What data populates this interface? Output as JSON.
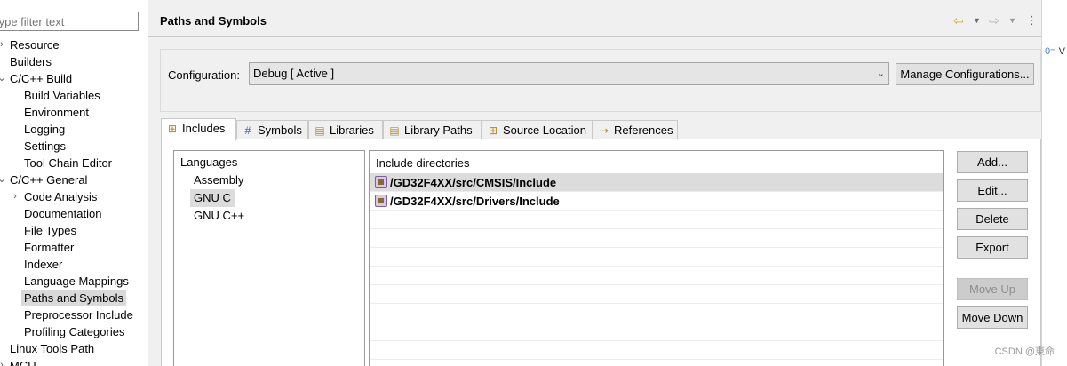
{
  "filter": {
    "placeholder": "type filter text"
  },
  "tree": [
    {
      "label": "Resource",
      "twisty": "›",
      "indent": 0
    },
    {
      "label": "Builders",
      "twisty": "",
      "indent": 0
    },
    {
      "label": "C/C++ Build",
      "twisty": "⌄",
      "indent": 0
    },
    {
      "label": "Build Variables",
      "twisty": "",
      "indent": 1
    },
    {
      "label": "Environment",
      "twisty": "",
      "indent": 1
    },
    {
      "label": "Logging",
      "twisty": "",
      "indent": 1
    },
    {
      "label": "Settings",
      "twisty": "",
      "indent": 1
    },
    {
      "label": "Tool Chain Editor",
      "twisty": "",
      "indent": 1
    },
    {
      "label": "C/C++ General",
      "twisty": "⌄",
      "indent": 0
    },
    {
      "label": "Code Analysis",
      "twisty": "›",
      "indent": 1
    },
    {
      "label": "Documentation",
      "twisty": "",
      "indent": 1
    },
    {
      "label": "File Types",
      "twisty": "",
      "indent": 1
    },
    {
      "label": "Formatter",
      "twisty": "",
      "indent": 1
    },
    {
      "label": "Indexer",
      "twisty": "",
      "indent": 1
    },
    {
      "label": "Language Mappings",
      "twisty": "",
      "indent": 1
    },
    {
      "label": "Paths and Symbols",
      "twisty": "",
      "indent": 1,
      "selected": true
    },
    {
      "label": "Preprocessor Include",
      "twisty": "",
      "indent": 1
    },
    {
      "label": "Profiling Categories",
      "twisty": "",
      "indent": 1
    },
    {
      "label": "Linux Tools Path",
      "twisty": "",
      "indent": 0
    },
    {
      "label": "MCU",
      "twisty": "›",
      "indent": 0
    }
  ],
  "page": {
    "title": "Paths and Symbols"
  },
  "config": {
    "label": "Configuration:",
    "value": "Debug  [ Active ]",
    "manage_label": "Manage Configurations..."
  },
  "tabs": [
    {
      "label": "Includes",
      "icon": "includes-icon",
      "glyph": "⊞"
    },
    {
      "label": "Symbols",
      "icon": "hash-icon",
      "glyph": "#"
    },
    {
      "label": "Libraries",
      "icon": "library-icon",
      "glyph": "▤"
    },
    {
      "label": "Library Paths",
      "icon": "library-path-icon",
      "glyph": "▤"
    },
    {
      "label": "Source Location",
      "icon": "folder-icon",
      "glyph": "⊞"
    },
    {
      "label": "References",
      "icon": "references-icon",
      "glyph": "⇢"
    }
  ],
  "languages": {
    "header": "Languages",
    "items": [
      "Assembly",
      "GNU C",
      "GNU C++"
    ],
    "selected": 1
  },
  "includes": {
    "header": "Include directories",
    "rows": [
      "/GD32F4XX/src/CMSIS/Include",
      "/GD32F4XX/src/Drivers/Include"
    ],
    "selected": 0
  },
  "buttons": {
    "add": "Add...",
    "edit": "Edit...",
    "delete": "Delete",
    "export": "Export",
    "move_up": "Move Up",
    "move_down": "Move Down"
  },
  "right_sliver": {
    "marker": "0=",
    "text": "V"
  },
  "watermark": "CSDN @東命"
}
